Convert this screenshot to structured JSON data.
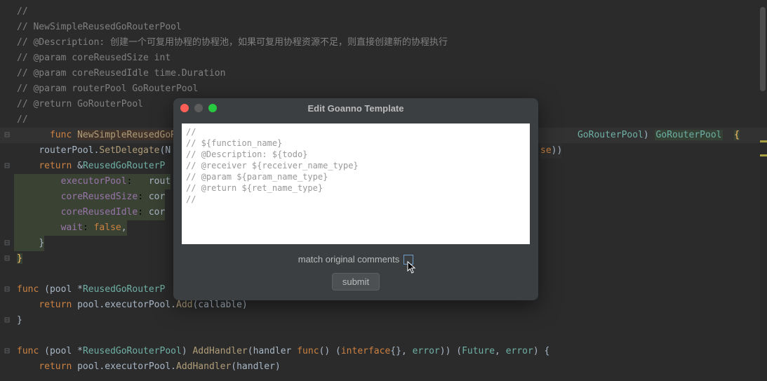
{
  "code": {
    "l1": "//",
    "l2": "// NewSimpleReusedGoRouterPool",
    "l3": "// @Description: 创建一个可复用协程的协程池，如果可复用协程资源不足，则直接创建新的协程执行",
    "l4": "// @param coreReusedSize int",
    "l5": "// @param coreReusedIdle time.Duration",
    "l6": "// @param routerPool GoRouterPool",
    "l7": "// @return GoRouterPool",
    "l8": "//",
    "func_kw": "func",
    "func_name": "NewSimpleReusedGoRouter",
    "ret_type_hint": "GoRouterPool",
    "ret_type": "GoRouterPool",
    "brace_open": "{",
    "l10_a": "routerPool.",
    "l10_b": "SetDelegate",
    "l10_c": "(N",
    "l10_end": "se))",
    "return_kw": "return",
    "amp": "&",
    "struct_name": "ReusedGoRouterP",
    "f1": "executorPool",
    "f1v": "rout",
    "f2": "coreReusedSize",
    "f2v": "cor",
    "f3": "coreReusedIdle",
    "f3v": "cor",
    "f4": "wait",
    "false_kw": "false",
    "close_brace2": "}",
    "close_brace1": "}",
    "func2_kw": "func",
    "func2_recv": "(pool *",
    "func2_type": "ReusedGoRouterP",
    "func2_return_kw": "return",
    "func2_body": " pool.executorPool.",
    "func2_method": "Add",
    "func2_arg": "(callable)",
    "func2_close": "}",
    "func3_kw": "func",
    "func3_recv": "(pool *",
    "func3_type": "ReusedGoRouterPool",
    "func3_close_recv": ") ",
    "func3_name": "AddHandler",
    "func3_params_a": "(handler ",
    "func3_func_kw": "func",
    "func3_params_b": "() (",
    "func3_iface": "interface",
    "func3_params_c": "{}, ",
    "func3_error1": "error",
    "func3_params_d": ")) (",
    "func3_future": "Future",
    "func3_params_e": ", ",
    "func3_error2": "error",
    "func3_params_f": ") {",
    "func3_return_kw": "return",
    "func3_body": " pool.executorPool.",
    "func3_method": "AddHandler",
    "func3_arg": "(handler)"
  },
  "dialog": {
    "title": "Edit Goanno Template",
    "template_text": "//\n// ${function_name}\n// @Description: ${todo}\n// @receiver ${receiver_name_type}\n// @param ${param_name_type}\n// @return ${ret_name_type}\n//",
    "checkbox_label": "match original comments",
    "submit_label": "submit"
  }
}
